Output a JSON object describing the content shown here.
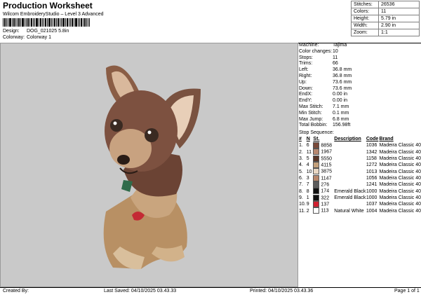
{
  "title": "Production Worksheet",
  "subtitle": "Wilcom EmbroideryStudio – Level 3 Advanced",
  "design": {
    "label": "Design:",
    "value": "DOG_021025 5.8in"
  },
  "colorway": {
    "label": "Colorway:",
    "value": "Colorway 1"
  },
  "summary": [
    {
      "label": "Stitches:",
      "value": "26536"
    },
    {
      "label": "Colors:",
      "value": "11"
    },
    {
      "label": "Height:",
      "value": "5.79 in"
    },
    {
      "label": "Width:",
      "value": "2.90 in"
    },
    {
      "label": "Zoom:",
      "value": "1:1"
    }
  ],
  "machine_info": [
    {
      "label": "Machine:",
      "value": "Tajima"
    },
    {
      "label": "Color changes:",
      "value": "10"
    },
    {
      "label": "Stops:",
      "value": "11"
    },
    {
      "label": "Trims:",
      "value": "66"
    },
    {
      "label": "Left:",
      "value": "36.8 mm"
    },
    {
      "label": "Right:",
      "value": "36.8 mm"
    },
    {
      "label": "Up:",
      "value": "73.6 mm"
    },
    {
      "label": "Down:",
      "value": "73.6 mm"
    },
    {
      "label": "EndX:",
      "value": "0.00 in"
    },
    {
      "label": "EndY:",
      "value": "0.00 in"
    },
    {
      "label": "Max Stitch:",
      "value": "7.1 mm"
    },
    {
      "label": "Min Stitch:",
      "value": "0.1 mm"
    },
    {
      "label": "Max Jump:",
      "value": "6.8 mm"
    },
    {
      "label": "Total Bobbin:",
      "value": "156.98ft"
    }
  ],
  "stop_sequence": {
    "label": "Stop Sequence:",
    "headers": {
      "num": "#",
      "n": "N",
      "st": "St.",
      "desc": "Description",
      "code": "Code",
      "brand": "Brand"
    },
    "rows": [
      {
        "num": "1.",
        "n": "6",
        "st": "8858",
        "desc": "",
        "code": "1036",
        "brand": "Madeira Classic 40",
        "color": "#7a4a3a"
      },
      {
        "num": "2.",
        "n": "11",
        "st": "1967",
        "desc": "",
        "code": "1342",
        "brand": "Madeira Classic 40",
        "color": "#b88870"
      },
      {
        "num": "3.",
        "n": "5",
        "st": "5550",
        "desc": "",
        "code": "1158",
        "brand": "Madeira Classic 40",
        "color": "#5a3628"
      },
      {
        "num": "4.",
        "n": "4",
        "st": "4115",
        "desc": "",
        "code": "1272",
        "brand": "Madeira Classic 40",
        "color": "#c4a07a"
      },
      {
        "num": "5.",
        "n": "10",
        "st": "3875",
        "desc": "",
        "code": "1013",
        "brand": "Madeira Classic 40",
        "color": "#e9d6c2"
      },
      {
        "num": "6.",
        "n": "3",
        "st": "1147",
        "desc": "",
        "code": "1056",
        "brand": "Madeira Classic 40",
        "color": "#b8866a"
      },
      {
        "num": "7.",
        "n": "7",
        "st": "276",
        "desc": "",
        "code": "1241",
        "brand": "Madeira Classic 40",
        "color": "#5c5c5c"
      },
      {
        "num": "8.",
        "n": "8",
        "st": "174",
        "desc": "Emerald Black",
        "code": "1000",
        "brand": "Madeira Classic 40",
        "color": "#101010"
      },
      {
        "num": "9.",
        "n": "1",
        "st": "322",
        "desc": "Emerald Black",
        "code": "1000",
        "brand": "Madeira Classic 40",
        "color": "#101010"
      },
      {
        "num": "10.",
        "n": "9",
        "st": "137",
        "desc": "",
        "code": "1037",
        "brand": "Madeira Classic 40",
        "color": "#d02030"
      },
      {
        "num": "11.",
        "n": "2",
        "st": "113",
        "desc": "Natural White",
        "code": "1004",
        "brand": "Madeira Classic 40",
        "color": "#ffffff"
      }
    ]
  },
  "footer": {
    "created_by": "Created By:",
    "last_saved": "Last Saved: 04/10/2025 03.43.33",
    "printed": "Printed: 04/10/2025 03.43.36",
    "page": "Page 1 of 1"
  }
}
